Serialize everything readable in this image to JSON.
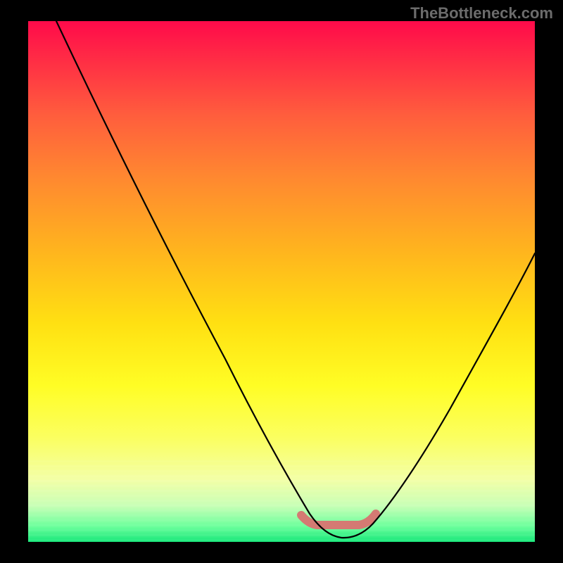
{
  "watermark": "TheBottleneck.com",
  "chart_data": {
    "type": "line",
    "title": "",
    "xlabel": "",
    "ylabel": "",
    "xlim": [
      0,
      100
    ],
    "ylim": [
      0,
      100
    ],
    "series": [
      {
        "name": "bottleneck-curve",
        "x": [
          0,
          5,
          10,
          15,
          20,
          25,
          30,
          35,
          40,
          45,
          50,
          55,
          58,
          60,
          63,
          65,
          68,
          72,
          76,
          82,
          88,
          94,
          100
        ],
        "y": [
          100,
          93,
          86,
          79,
          71,
          63,
          54,
          45,
          36,
          26,
          16,
          7,
          3,
          1,
          0,
          1,
          3,
          8,
          14,
          24,
          35,
          47,
          58
        ]
      }
    ],
    "annotations": [
      {
        "name": "optimal-valley-marker",
        "x_range": [
          55,
          70
        ],
        "y": 2,
        "color": "#d47a73"
      }
    ]
  }
}
